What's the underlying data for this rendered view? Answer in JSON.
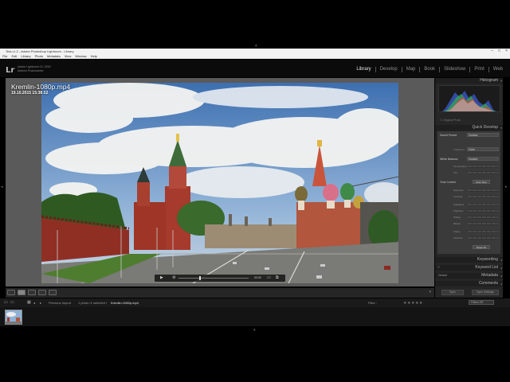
{
  "window": {
    "title": "Test-Lr-2 - Adobe Photoshop Lightroom - Library"
  },
  "menu": [
    "File",
    "Edit",
    "Library",
    "Photo",
    "Metadata",
    "View",
    "Window",
    "Help"
  ],
  "identity": {
    "logo": "Lr",
    "line1": "Adobe Lightroom CC 2015",
    "line2": "Antonio Prokonaninn"
  },
  "modules": [
    "Library",
    "Develop",
    "Map",
    "Book",
    "Slideshow",
    "Print",
    "Web"
  ],
  "active_module": "Library",
  "photo": {
    "filename": "Kremlin-1080p.mp4",
    "datetime": "19.10.2015 15:38:52"
  },
  "player": {
    "time": "00:00",
    "progress": 0.3
  },
  "panels": {
    "histogram": "Histogram",
    "original_photo": "Original Photo",
    "quick_develop": "Quick Develop",
    "saved_preset_label": "Saved Preset",
    "saved_preset_value": "Custom",
    "treatment_label": "Treatment",
    "treatment_value": "Color",
    "white_balance_label": "White Balance",
    "white_balance_value": "Custom",
    "temperature": "Temperature",
    "tint": "Tint",
    "tone_control_label": "Tone Control",
    "auto_tone": "Auto Tone",
    "exposure": "Exposure",
    "contrast": "Contrast",
    "highlights": "Highlights",
    "shadows": "Shadows",
    "whites": "Whites",
    "blacks": "Blacks",
    "clarity": "Clarity",
    "vibrance": "Vibrance",
    "reset_all": "Reset All",
    "keywording": "Keywording",
    "keyword_list": "Keyword List",
    "metadata": "Metadata",
    "metadata_preset": "Default",
    "comments": "Comments",
    "sync": "Sync",
    "sync_settings": "Sync Settings"
  },
  "filmstrip": {
    "source": "Previous Import",
    "count": "1 photo /1 selected /",
    "selected_file": "Kremlin-1080p.mp4",
    "filter_label": "Filter :",
    "filter_value": "Filters Off"
  },
  "colors": {
    "active": "#e6e6e6",
    "panel_bg": "#262626",
    "background": "#000000"
  }
}
